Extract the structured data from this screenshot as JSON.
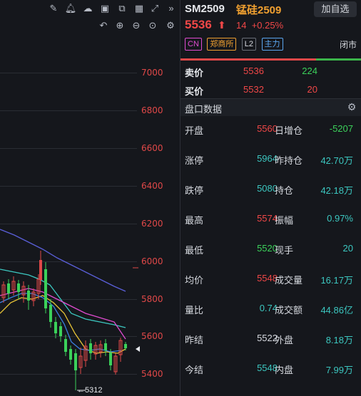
{
  "header": {
    "symbol": "SM2509",
    "name": "锰硅2509",
    "watchlist_button": "加自选",
    "last_price": "5536",
    "change": "14",
    "change_pct": "+0.25%",
    "tags": [
      "CN",
      "郑商所",
      "L2",
      "主力"
    ],
    "status": "闭市"
  },
  "orderbook": {
    "ask_label": "卖价",
    "ask_price": "5536",
    "ask_volume": "224",
    "bid_label": "买价",
    "bid_price": "5532",
    "bid_volume": "20"
  },
  "panel": {
    "title": "盘口数据",
    "rows": [
      {
        "l1": "开盘",
        "v1": "5560",
        "l2": "日增仓",
        "v2": "-5207"
      },
      {
        "l1": "涨停",
        "v1": "5964",
        "l2": "昨持仓",
        "v2": "42.70万"
      },
      {
        "l1": "跌停",
        "v1": "5080",
        "l2": "持仓",
        "v2": "42.18万"
      },
      {
        "l1": "最高",
        "v1": "5574",
        "l2": "振幅",
        "v2": "0.97%"
      },
      {
        "l1": "最低",
        "v1": "5520",
        "l2": "现手",
        "v2": "20"
      },
      {
        "l1": "均价",
        "v1": "5548",
        "l2": "成交量",
        "v2": "16.17万"
      },
      {
        "l1": "量比",
        "v1": "0.74",
        "l2": "成交额",
        "v2": "44.86亿"
      },
      {
        "l1": "昨结",
        "v1": "5522",
        "l2": "外盘",
        "v2": "8.18万"
      },
      {
        "l1": "今结",
        "v1": "5548",
        "l2": "内盘",
        "v2": "7.99万"
      }
    ]
  },
  "chart": {
    "y_ticks": [
      "7000",
      "6800",
      "6600",
      "6400",
      "6200",
      "6000",
      "5800",
      "5600",
      "5400"
    ],
    "low_marker": "5312"
  },
  "toolbar_icons": [
    "edit-icon",
    "bell-icon",
    "cloud-icon",
    "camera-icon",
    "copy-icon",
    "layout-icon",
    "fullscreen-icon",
    "collapse-icon"
  ],
  "colors": {
    "up": "#f04747",
    "down": "#3bd15a",
    "teal": "#3cc7c0",
    "accent": "#f0a030"
  }
}
